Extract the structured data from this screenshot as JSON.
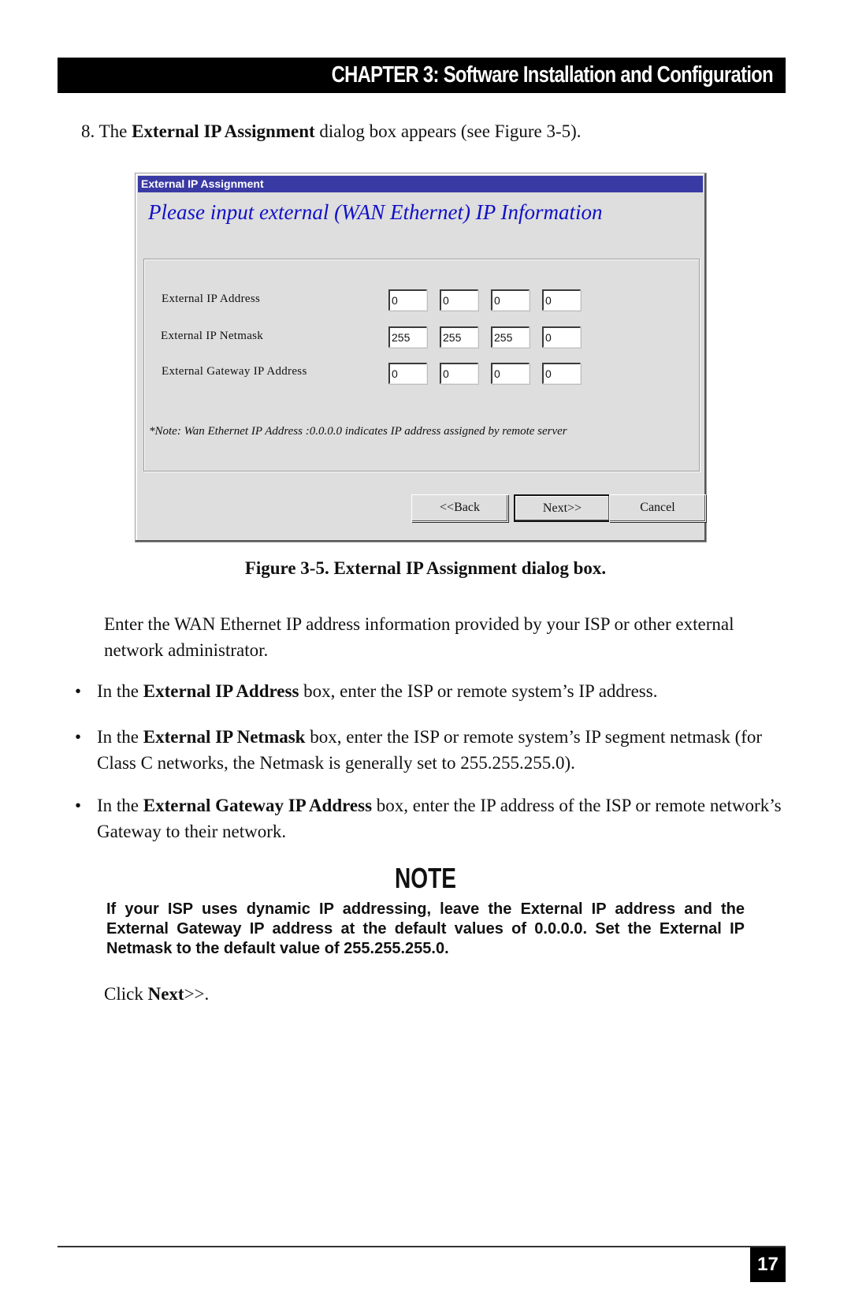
{
  "header": {
    "chapter_title": "CHAPTER 3: Software Installation and Configuration"
  },
  "step": {
    "prefix": "8. The ",
    "bold": "External IP Assignment",
    "suffix": " dialog box appears (see Figure 3-5)."
  },
  "dialog": {
    "title": "External IP Assignment",
    "title_bar_color": "#3a3aa4",
    "heading": "Please input external (WAN Ethernet) IP Information",
    "heading_color": "#1010c8",
    "fields": [
      {
        "label": "External IP Address",
        "octets": [
          "0",
          "0",
          "0",
          "0"
        ]
      },
      {
        "label": "External IP Netmask",
        "octets": [
          "255",
          "255",
          "255",
          "0"
        ]
      },
      {
        "label": "External Gateway IP Address",
        "octets": [
          "0",
          "0",
          "0",
          "0"
        ]
      }
    ],
    "note": "*Note: Wan Ethernet IP Address :0.0.0.0 indicates IP address assigned by remote server",
    "buttons": {
      "back": "<<Back",
      "next": "Next>>",
      "cancel": "Cancel"
    }
  },
  "caption": "Figure 3-5. External IP Assignment dialog box.",
  "intro": "Enter the WAN Ethernet IP address information provided by your ISP or other external network administrator.",
  "bullets": [
    {
      "prefix": "In the ",
      "bold": "External IP Address",
      "suffix": " box, enter the ISP or remote system’s IP address."
    },
    {
      "prefix": "In the ",
      "bold": "External IP Netmask",
      "suffix": " box, enter the ISP or remote system’s IP segment netmask  (for Class C networks, the Netmask is generally set to 255.255.255.0)."
    },
    {
      "prefix": "In the ",
      "bold": "External Gateway IP Address",
      "suffix": " box, enter the IP address of the ISP or remote network’s Gateway to their network."
    }
  ],
  "bullet_glyph": "•",
  "note": {
    "title": "NOTE",
    "body": "If your ISP uses dynamic IP addressing, leave the External IP address and the External Gateway IP address at the default values of 0.0.0.0.  Set the External IP Netmask to the default value of 255.255.255.0."
  },
  "click_next": {
    "prefix": "Click ",
    "bold": "Next",
    "suffix": ">>."
  },
  "footer": {
    "page_number": "17"
  }
}
